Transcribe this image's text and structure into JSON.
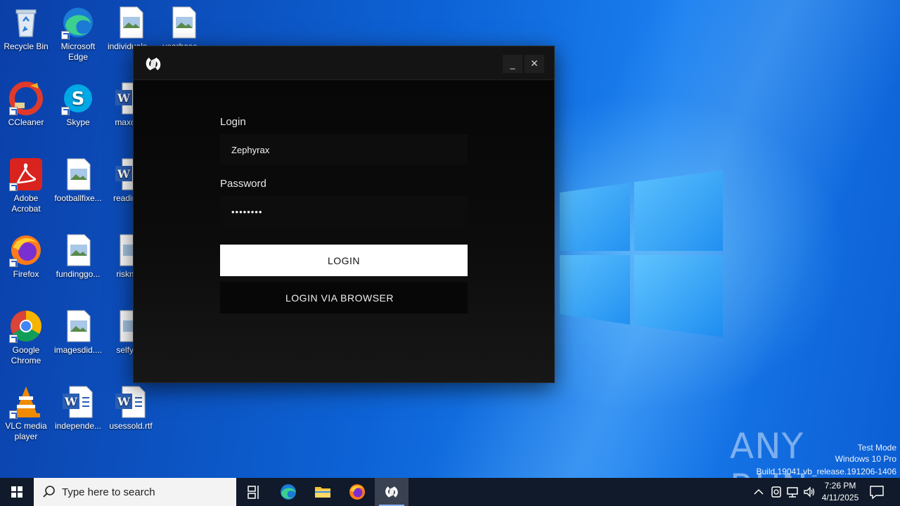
{
  "desktop": {
    "icons": [
      {
        "label": "Recycle Bin",
        "icon": "recycle-bin-icon"
      },
      {
        "label": "Microsoft Edge",
        "icon": "edge-icon"
      },
      {
        "label": "individuals...",
        "icon": "image-file-icon"
      },
      {
        "label": "yearbase...",
        "icon": "image-file-icon"
      },
      {
        "label": "CCleaner",
        "icon": "ccleaner-icon"
      },
      {
        "label": "Skype",
        "icon": "skype-icon"
      },
      {
        "label": "maxce...",
        "icon": "word-doc-icon"
      },
      {
        "label": "Adobe Acrobat",
        "icon": "acrobat-icon"
      },
      {
        "label": "footballfixe...",
        "icon": "image-file-icon"
      },
      {
        "label": "reading...",
        "icon": "word-doc-icon"
      },
      {
        "label": "Firefox",
        "icon": "firefox-icon"
      },
      {
        "label": "fundinggo...",
        "icon": "image-file-icon"
      },
      {
        "label": "riskmi...",
        "icon": "image-file-icon"
      },
      {
        "label": "Google Chrome",
        "icon": "chrome-icon"
      },
      {
        "label": "imagesdid....",
        "icon": "image-file-icon"
      },
      {
        "label": "selfye...",
        "icon": "image-file-icon"
      },
      {
        "label": "VLC media player",
        "icon": "vlc-icon"
      },
      {
        "label": "independe...",
        "icon": "word-doc-icon"
      },
      {
        "label": "usessold.rtf",
        "icon": "word-doc-icon"
      }
    ]
  },
  "app": {
    "minimize_label": "_",
    "close_label": "✕",
    "login_label": "Login",
    "login_value": "Zephyrax",
    "password_label": "Password",
    "password_value": "••••••••",
    "login_button": "LOGIN",
    "browser_button": "LOGIN VIA BROWSER"
  },
  "watermark": {
    "brand": "ANY RUN",
    "test_mode": "Test Mode",
    "edition": "Windows 10 Pro",
    "build": "Build 19041.vb_release.191206-1406"
  },
  "taskbar": {
    "search_placeholder": "Type here to search",
    "time": "7:26 PM",
    "date": "4/11/2025",
    "apps": [
      "task-view-icon",
      "edge-icon",
      "file-explorer-icon",
      "firefox-icon",
      "app-logo-icon"
    ]
  },
  "colors": {
    "desktop_blue": "#0d63d6",
    "window_bg": "#0c0c0c",
    "login_button_bg": "#ffffff",
    "taskbar_bg": "#101a2a"
  }
}
